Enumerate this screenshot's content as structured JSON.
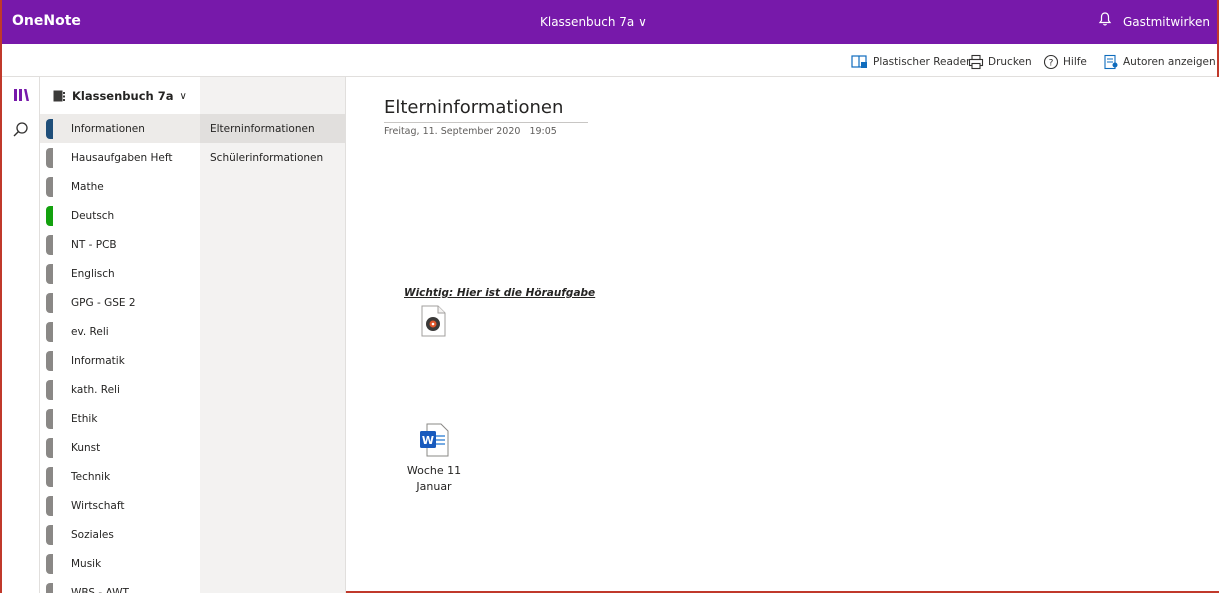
{
  "titlebar": {
    "app_name": "OneNote",
    "notebook_title": "Klassenbuch 7a ∨",
    "user_name": "Gastmitwirken",
    "bell_icon": "bell-icon",
    "accent_color": "#7719aa"
  },
  "ribbon": {
    "immersive_reader": "Plastischer Reader",
    "print": "Drucken",
    "help": "Hilfe",
    "show_authors": "Autoren anzeigen"
  },
  "rail": {
    "notebooks_icon": "notebooks-icon",
    "search_icon": "search-icon"
  },
  "notebook": {
    "name": "Klassenbuch 7a",
    "chevron": "∨"
  },
  "sections": [
    {
      "label": "Informationen",
      "color": "#1f4e79",
      "active": true
    },
    {
      "label": "Hausaufgaben Heft",
      "color": "#8a8886"
    },
    {
      "label": "Mathe",
      "color": "#8a8886"
    },
    {
      "label": "Deutsch",
      "color": "#13a10e"
    },
    {
      "label": "NT - PCB",
      "color": "#8a8886"
    },
    {
      "label": "Englisch",
      "color": "#8a8886"
    },
    {
      "label": "GPG - GSE 2",
      "color": "#8a8886"
    },
    {
      "label": "ev. Reli",
      "color": "#8a8886"
    },
    {
      "label": "Informatik",
      "color": "#8a8886"
    },
    {
      "label": "kath. Reli",
      "color": "#8a8886"
    },
    {
      "label": "Ethik",
      "color": "#8a8886"
    },
    {
      "label": "Kunst",
      "color": "#8a8886"
    },
    {
      "label": "Technik",
      "color": "#8a8886"
    },
    {
      "label": "Wirtschaft",
      "color": "#8a8886"
    },
    {
      "label": "Soziales",
      "color": "#8a8886"
    },
    {
      "label": "Musik",
      "color": "#8a8886"
    },
    {
      "label": "WBS - AWT",
      "color": "#8a8886"
    }
  ],
  "pages": [
    {
      "label": "Elterninformationen",
      "active": true
    },
    {
      "label": "Schülerinformationen"
    }
  ],
  "page": {
    "title": "Elterninformationen",
    "date": "Freitag, 11. September 2020",
    "time": "19:05",
    "important_note": "Wichtig: Hier ist die Höraufgabe",
    "audio_attachment_icon": "audio-file-icon",
    "word_attachment_icon": "word-document-icon",
    "word_file_line1": "Woche 11",
    "word_file_line2": "Januar"
  }
}
